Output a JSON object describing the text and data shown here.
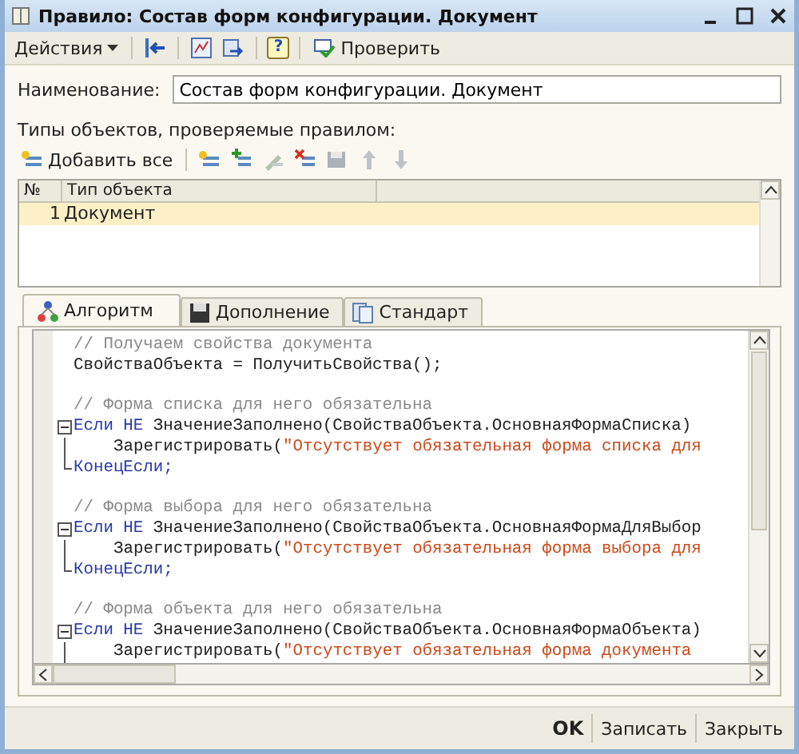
{
  "window": {
    "title": "Правило: Состав форм конфигурации. Документ"
  },
  "toolbar": {
    "actions_label": "Действия",
    "help_label": "?",
    "check_label": "Проверить"
  },
  "name_field": {
    "label": "Наименование:",
    "value": "Состав форм конфигурации. Документ"
  },
  "object_types": {
    "label": "Типы объектов, проверяемые правилом:",
    "add_all_label": "Добавить все",
    "tools": [
      {
        "kind": "add",
        "disabled": false
      },
      {
        "kind": "edit",
        "disabled": true
      },
      {
        "kind": "delete",
        "disabled": false
      },
      {
        "kind": "save",
        "disabled": true
      },
      {
        "kind": "up",
        "disabled": true
      },
      {
        "kind": "down",
        "disabled": true
      }
    ],
    "columns": [
      "№",
      "Тип объекта"
    ],
    "rows": [
      {
        "number": "1",
        "type": "Документ",
        "selected": true
      }
    ]
  },
  "tabs": [
    {
      "label": "Алгоритм",
      "kind": "algorithm",
      "selected": true
    },
    {
      "label": "Дополнение",
      "kind": "addition",
      "selected": false
    },
    {
      "label": "Стандарт",
      "kind": "standard",
      "selected": false
    }
  ],
  "code": [
    {
      "kind": "comment",
      "text": "// Получаем свойства документа"
    },
    {
      "kind": "statement",
      "tokens": [
        {
          "kind": "plain",
          "text": "СвойстваОбъекта = ПолучитьСвойства();"
        }
      ]
    },
    {
      "kind": "blank"
    },
    {
      "kind": "comment",
      "text": "// Форма списка для него обязательна"
    },
    {
      "kind": "if",
      "expanded": true,
      "tokens": [
        {
          "kind": "keyword",
          "text": "Если НЕ"
        },
        {
          "kind": "plain",
          "text": "ЗначениеЗаполнено(СвойстваОбъекта.ОсновнаяФормаСписка)"
        }
      ],
      "children": [
        {
          "kind": "statement",
          "tokens": [
            {
              "kind": "plain",
              "text": "Зарегистрировать("
            },
            {
              "kind": "string",
              "text": "\"Отсутствует обязательная форма списка для"
            }
          ]
        }
      ],
      "end": "КонецЕсли;"
    },
    {
      "kind": "blank"
    },
    {
      "kind": "comment",
      "text": "// Форма выбора для него обязательна"
    },
    {
      "kind": "if",
      "expanded": true,
      "tokens": [
        {
          "kind": "keyword",
          "text": "Если НЕ"
        },
        {
          "kind": "plain",
          "text": "ЗначениеЗаполнено(СвойстваОбъекта.ОсновнаяФормаДляВыбор"
        }
      ],
      "children": [
        {
          "kind": "statement",
          "tokens": [
            {
              "kind": "plain",
              "text": "Зарегистрировать("
            },
            {
              "kind": "string",
              "text": "\"Отсутствует обязательная форма выбора для"
            }
          ]
        }
      ],
      "end": "КонецЕсли;"
    },
    {
      "kind": "blank"
    },
    {
      "kind": "comment",
      "text": "// Форма объекта для него обязательна"
    },
    {
      "kind": "if",
      "expanded": true,
      "tokens": [
        {
          "kind": "keyword",
          "text": "Если НЕ"
        },
        {
          "kind": "plain",
          "text": "ЗначениеЗаполнено(СвойстваОбъекта.ОсновнаяФормаОбъекта)"
        }
      ],
      "children": [
        {
          "kind": "statement",
          "tokens": [
            {
              "kind": "plain",
              "text": "Зарегистрировать("
            },
            {
              "kind": "string",
              "text": "\"Отсутствует обязательная форма документа"
            }
          ]
        }
      ]
    }
  ],
  "buttons": [
    {
      "label": "OK",
      "kind": "default"
    },
    {
      "label": "Записать",
      "kind": "normal"
    },
    {
      "label": "Закрыть",
      "kind": "normal"
    }
  ]
}
